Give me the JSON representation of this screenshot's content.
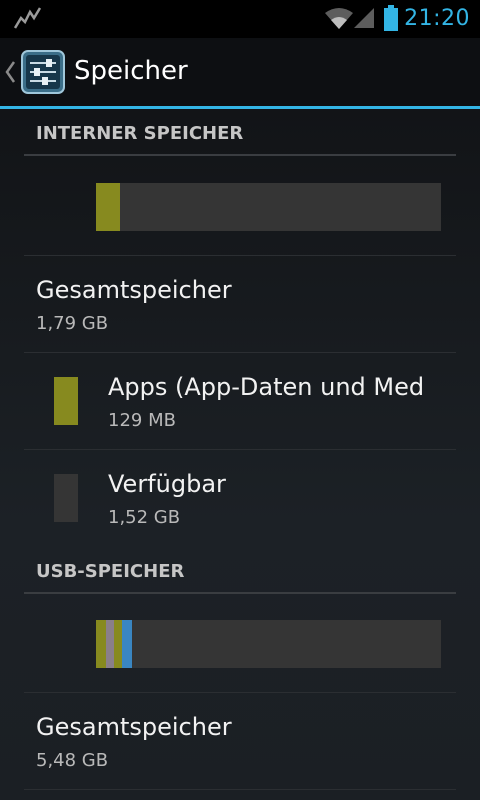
{
  "status_bar": {
    "time": "21:20",
    "icons": [
      "activity-icon",
      "wifi-icon",
      "signal-icon",
      "battery-icon"
    ],
    "accent": "#33b5e5"
  },
  "action_bar": {
    "title": "Speicher",
    "icons": [
      "back-chevron-icon",
      "settings-app-icon"
    ]
  },
  "internal": {
    "header": "INTERNER SPEICHER",
    "usage_fraction": 0.07,
    "colors": {
      "apps": "#878a1f",
      "free": "#353535"
    },
    "total_label": "Gesamtspeicher",
    "total_value": "1,79 GB",
    "items": [
      {
        "label": "Apps (App-Daten und Med",
        "value": "129 MB",
        "color": "#878a1f"
      },
      {
        "label": "Verfügbar",
        "value": "1,52 GB",
        "color": "#353535"
      }
    ]
  },
  "usb": {
    "header": "USB-SPEICHER",
    "segment_colors": [
      "#878a1f",
      "#8a7f8a",
      "#878a1f",
      "#3a86c1"
    ],
    "total_label": "Gesamtspeicher",
    "total_value": "5,48 GB"
  }
}
